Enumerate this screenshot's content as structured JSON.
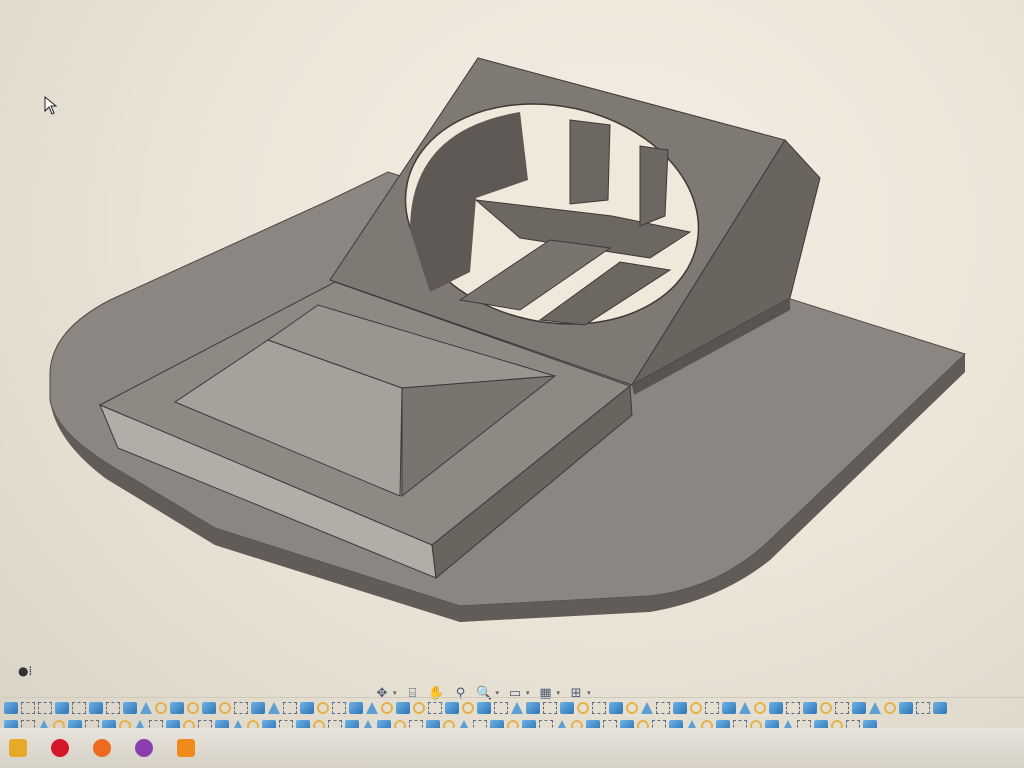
{
  "viewport": {
    "model": "enclosure-stand",
    "colors": {
      "model_top": "#8c8682",
      "model_side": "#6d6762",
      "model_dark": "#5a5450",
      "model_light": "#a7a19c",
      "edge": "#3e3935"
    }
  },
  "navigation_toolbar": {
    "items": [
      {
        "icon": "orbit-icon",
        "glyph": "✥",
        "has_menu": true
      },
      {
        "icon": "look-at-icon",
        "glyph": "⌸",
        "has_menu": false
      },
      {
        "icon": "pan-icon",
        "glyph": "✋",
        "has_menu": false
      },
      {
        "icon": "zoom-icon",
        "glyph": "⚲",
        "has_menu": false
      },
      {
        "icon": "zoom-window-icon",
        "glyph": "🔍",
        "has_menu": true
      },
      {
        "icon": "display-settings-icon",
        "glyph": "▭",
        "has_menu": true
      },
      {
        "icon": "grid-icon",
        "glyph": "▦",
        "has_menu": true
      },
      {
        "icon": "viewports-icon",
        "glyph": "⊞",
        "has_menu": true
      }
    ]
  },
  "timeline": {
    "row1": [
      "cube",
      "sketch",
      "sketch",
      "cube",
      "sketch",
      "cube",
      "sketch",
      "cube",
      "tri",
      "circle",
      "cube",
      "circle",
      "cube",
      "circle",
      "sketch",
      "cube",
      "tri",
      "sketch",
      "cube",
      "circle",
      "sketch",
      "cube",
      "tri",
      "circle",
      "cube",
      "circle",
      "sketch",
      "cube",
      "circle",
      "cube",
      "sketch",
      "tri",
      "cube",
      "sketch",
      "cube",
      "circle",
      "sketch",
      "cube",
      "circle",
      "tri",
      "sketch",
      "cube",
      "circle",
      "sketch",
      "cube",
      "tri",
      "circle",
      "cube",
      "sketch",
      "cube",
      "circle",
      "sketch",
      "cube",
      "tri",
      "circle",
      "cube",
      "sketch",
      "cube"
    ],
    "row2": [
      "cube",
      "sketch",
      "tri",
      "circle",
      "cube",
      "sketch",
      "cube",
      "circle",
      "tri",
      "sketch",
      "cube",
      "circle",
      "sketch",
      "cube",
      "tri",
      "circle",
      "cube",
      "sketch",
      "cube",
      "circle",
      "sketch",
      "cube",
      "tri",
      "cube",
      "circle",
      "sketch",
      "cube",
      "circle",
      "tri",
      "sketch",
      "cube",
      "circle",
      "cube",
      "sketch",
      "tri",
      "circle",
      "cube",
      "sketch",
      "cube",
      "circle",
      "sketch",
      "cube",
      "tri",
      "circle",
      "cube",
      "sketch",
      "circle",
      "cube",
      "tri",
      "sketch",
      "cube",
      "circle",
      "sketch",
      "cube"
    ]
  },
  "taskbar": {
    "items": [
      {
        "icon": "file-explorer-icon",
        "color": "#e6a928"
      },
      {
        "icon": "opera-icon",
        "color": "#d4182b"
      },
      {
        "icon": "firefox-icon",
        "color": "#ec6b1d"
      },
      {
        "icon": "app-icon",
        "color": "#8a3fb0"
      },
      {
        "icon": "fusion-icon",
        "color": "#f08a1b"
      }
    ]
  }
}
